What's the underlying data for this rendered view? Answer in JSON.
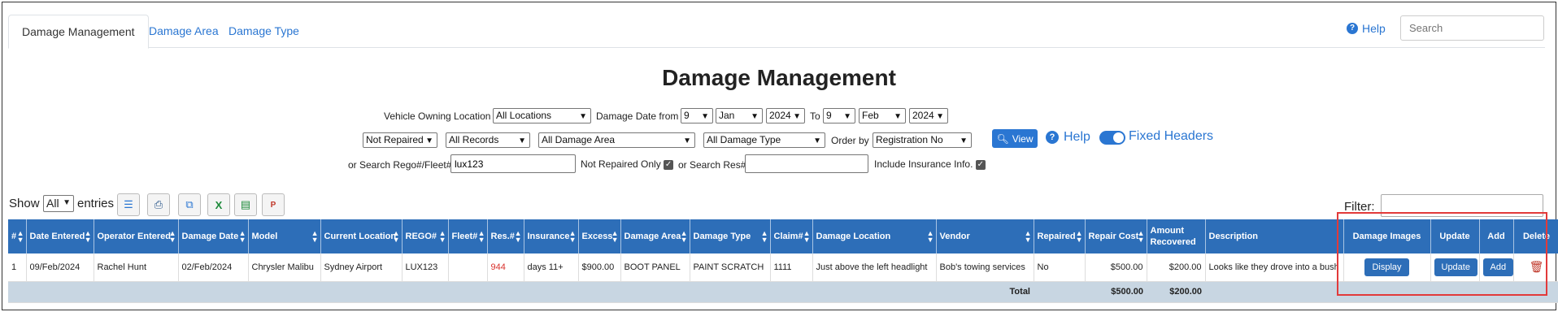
{
  "tabs": [
    {
      "label": "Damage Management",
      "active": true
    },
    {
      "label": "Damage Area",
      "active": false
    },
    {
      "label": "Damage Type",
      "active": false
    }
  ],
  "header": {
    "help_label": "Help",
    "search_placeholder": "Search"
  },
  "page_title": "Damage Management",
  "filters": {
    "owning_location_label": "Vehicle Owning Location",
    "owning_location_value": "All Locations",
    "damage_date_from_label": "Damage Date from",
    "from_day": "9",
    "from_month": "Jan",
    "from_year": "2024",
    "to_label": "To",
    "to_day": "9",
    "to_month": "Feb",
    "to_year": "2024",
    "repaired_value": "Not Repaired",
    "records_value": "All Records",
    "damage_area_value": "All Damage Area",
    "damage_type_value": "All Damage Type",
    "order_by_label": "Order by",
    "order_by_value": "Registration No",
    "view_label": "View",
    "help_label": "Help",
    "fixed_headers_label": "Fixed Headers",
    "rego_label": "or Search Rego#/Fleet#",
    "rego_value": "lux123",
    "not_repaired_only_label": "Not Repaired Only",
    "res_label": "or Search Res#",
    "res_value": "",
    "include_insurance_label": "Include Insurance Info."
  },
  "toolbar": {
    "show_label": "Show",
    "entries_value": "All",
    "entries_label": "entries",
    "filter_label": "Filter:"
  },
  "table": {
    "headers": [
      "#",
      "Date Entered",
      "Operator Entered",
      "Damage Date",
      "Model",
      "Current Location",
      "REGO#",
      "Fleet#",
      "Res.#",
      "Insurance",
      "Excess",
      "Damage Area",
      "Damage Type",
      "Claim#",
      "Damage Location",
      "Vendor",
      "Repaired",
      "Repair Cost",
      "Amount Recovered",
      "Description",
      "Damage Images",
      "Update",
      "Add",
      "Delete"
    ],
    "rows": [
      {
        "num": "1",
        "date_entered": "09/Feb/2024",
        "operator": "Rachel Hunt",
        "damage_date": "02/Feb/2024",
        "model": "Chrysler Malibu",
        "location": "Sydney Airport",
        "rego": "LUX123",
        "fleet": "",
        "res": "944",
        "insurance": "days 11+",
        "excess": "$900.00",
        "damage_area": "BOOT PANEL",
        "damage_type": "PAINT SCRATCH",
        "claim": "1111",
        "damage_location": "Just above the left headlight",
        "vendor": "Bob's towing services",
        "repaired": "No",
        "repair_cost": "$500.00",
        "recovered": "$200.00",
        "description": "Looks like they drove into a bush",
        "display_label": "Display",
        "update_label": "Update",
        "add_label": "Add"
      }
    ],
    "total_label": "Total",
    "total_repair_cost": "$500.00",
    "total_recovered": "$200.00"
  },
  "colors": {
    "accent": "#2a76d2",
    "header_bg": "#2d6eb8",
    "highlight": "#e23a3a",
    "res_text": "#d9302b"
  }
}
